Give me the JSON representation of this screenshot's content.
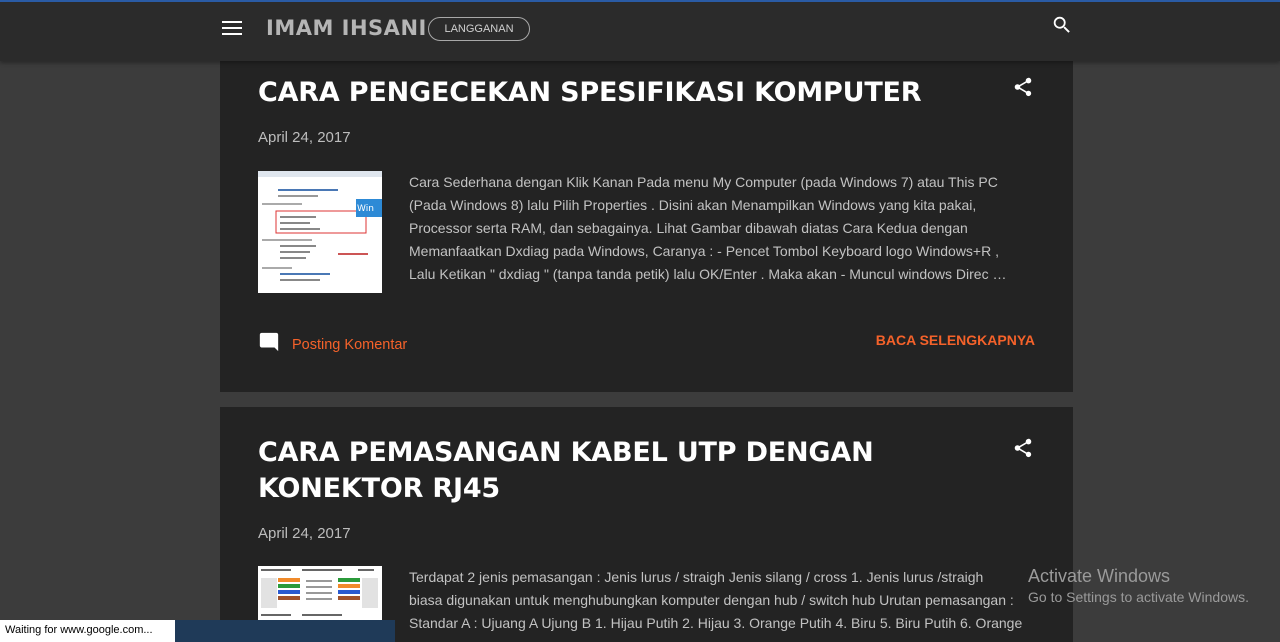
{
  "header": {
    "blog_title": "IMAM IHSANI",
    "subscribe_label": "LANGGANAN"
  },
  "posts": [
    {
      "title": "CARA PENGECEKAN SPESIFIKASI KOMPUTER",
      "date": "April 24, 2017",
      "snippet_lines": [
        "Cara Sederhana dengan  Klik Kanan  Pada menu  My Computer  (pada Windows 7) atau  This PC",
        " (Pada Windows 8) lalu Pilih  Properties . Disini akan Menampilkan Windows yang kita pakai,",
        "Processor serta RAM, dan sebagainya. Lihat Gambar dibawah diatas Cara Kedua dengan",
        "Memanfaatkan Dxdiag pada Windows,  Caranya  : -  Pencet Tombol Keyboard logo  Windows+R ,",
        "Lalu Ketikan \" dxdiag \" (tanpa tanda petik) lalu   OK/Enter . Maka akan  - Muncul windows  Direc …"
      ],
      "comment_label": "Posting Komentar",
      "read_more_label": "BACA SELENGKAPNYA"
    },
    {
      "title": "CARA PEMASANGAN KABEL UTP DENGAN KONEKTOR RJ45",
      "date": "April 24, 2017",
      "snippet_lines": [
        "Terdapat 2 jenis pemasangan : Jenis  lurus / straigh Jenis  silang / cross 1.  Jenis lurus /straigh",
        "biasa digunakan untuk menghubungkan komputer dengan hub / switch hub Urutan pemasangan :",
        "Standar A : Ujuang A Ujung B 1. Hijau Putih 2. Hijau 3. Orange Putih 4. Biru 5. Biru Putih 6. Orange"
      ]
    }
  ],
  "status_bar": {
    "text": "Waiting for www.google.com..."
  },
  "watermark": {
    "line1": "Activate Windows",
    "line2": "Go to Settings to activate Windows."
  },
  "colors": {
    "accent": "#f5622a",
    "header_bg": "#2b2b2b",
    "post_bg": "#232323",
    "page_bg": "#3c3c3c"
  },
  "icons": [
    "menu-icon",
    "search-icon",
    "share-icon",
    "comment-icon"
  ]
}
